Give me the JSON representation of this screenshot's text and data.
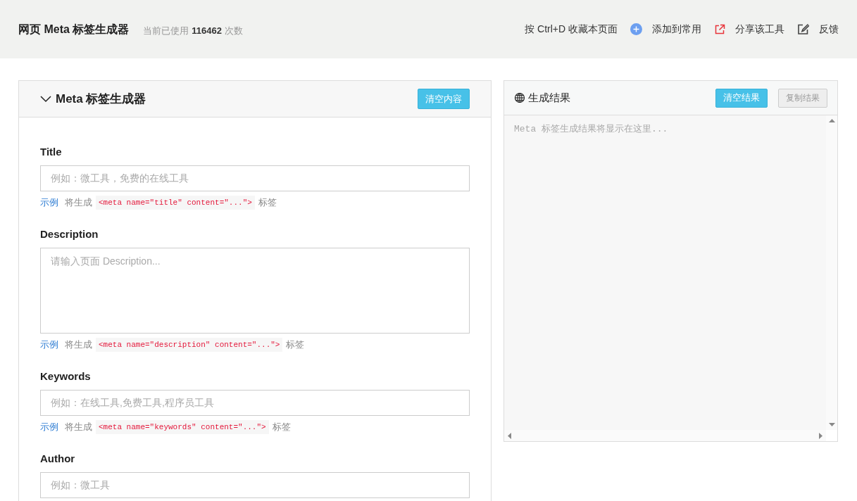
{
  "header": {
    "title": "网页 Meta 标签生成器",
    "usage_prefix": "当前已使用",
    "usage_count": "116462",
    "usage_suffix": "次数",
    "actions": [
      {
        "kind": "text",
        "label": "按 Ctrl+D 收藏本页面"
      },
      {
        "kind": "plus",
        "label": "添加到常用"
      },
      {
        "kind": "share",
        "label": "分享该工具"
      },
      {
        "kind": "edit",
        "label": "反馈"
      }
    ]
  },
  "generator": {
    "title": "Meta 标签生成器",
    "expanded": true,
    "clear_button": "清空内容",
    "fields": [
      {
        "label": "Title",
        "kind": "input",
        "placeholder": "例如：微工具，免费的在线工具",
        "hint": {
          "link": "示例",
          "before": "将生成",
          "code": "<meta name=\"title\" content=\"...\">",
          "after": "标签"
        }
      },
      {
        "label": "Description",
        "kind": "textarea",
        "placeholder": "请输入页面 Description...",
        "hint": {
          "link": "示例",
          "before": "将生成",
          "code": "<meta name=\"description\" content=\"...\">",
          "after": "标签"
        }
      },
      {
        "label": "Keywords",
        "kind": "input",
        "placeholder": "例如：在线工具,免费工具,程序员工具",
        "hint": {
          "link": "示例",
          "before": "将生成",
          "code": "<meta name=\"keywords\" content=\"...\">",
          "after": "标签"
        }
      },
      {
        "label": "Author",
        "kind": "input",
        "placeholder": "例如：微工具"
      }
    ]
  },
  "result": {
    "title": "生成结果",
    "buttons": [
      {
        "label": "清空结果",
        "disabled": false
      },
      {
        "label": "复制结果",
        "disabled": true
      }
    ],
    "placeholder": "Meta 标签生成结果将显示在这里..."
  }
}
